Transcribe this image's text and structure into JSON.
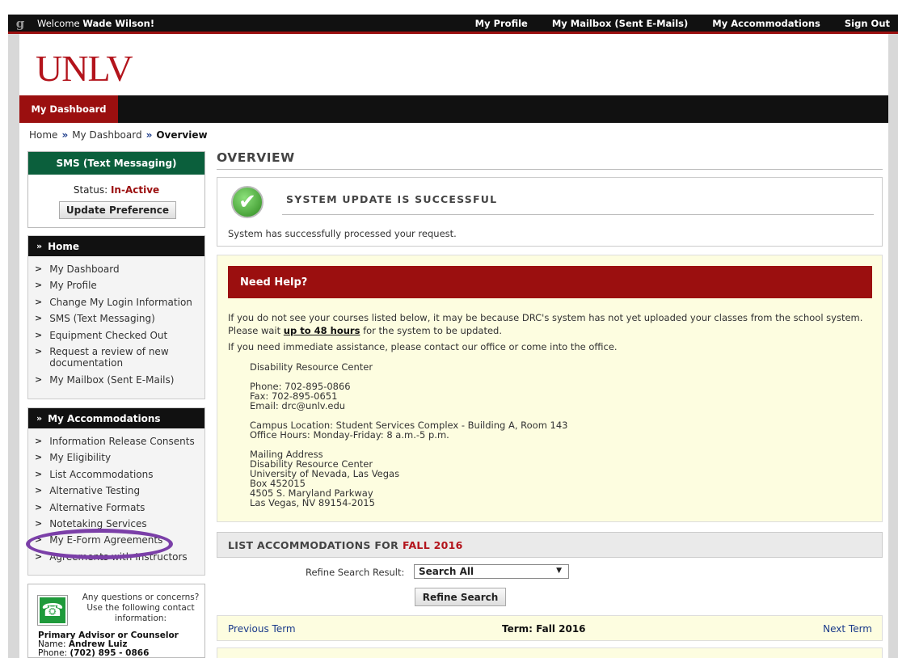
{
  "topbar": {
    "welcome_prefix": "Welcome",
    "user_name": "Wade Wilson!",
    "links": [
      "My Profile",
      "My Mailbox (Sent E-Mails)",
      "My Accommodations",
      "Sign Out"
    ]
  },
  "brand": {
    "name": "UNLV"
  },
  "nav": {
    "active_tab": "My Dashboard"
  },
  "breadcrumb": {
    "home": "Home",
    "dashboard": "My Dashboard",
    "current": "Overview",
    "sep": "»"
  },
  "sms": {
    "title": "SMS (Text Messaging)",
    "status_label": "Status:",
    "status_value": "In-Active",
    "button": "Update Preference"
  },
  "home_section": {
    "title": "Home",
    "items": [
      "My Dashboard",
      "My Profile",
      "Change My Login Information",
      "SMS (Text Messaging)",
      "Equipment Checked Out",
      "Request a review of new documentation",
      "My Mailbox (Sent E-Mails)"
    ]
  },
  "accommodations_section": {
    "title": "My Accommodations",
    "items": [
      "Information Release Consents",
      "My Eligibility",
      "List Accommodations",
      "Alternative Testing",
      "Alternative Formats",
      "Notetaking Services",
      "My E-Form Agreements",
      "Agreements with Instructors"
    ]
  },
  "contact": {
    "message": "Any questions or concerns? Use the following contact information:",
    "role": "Primary Advisor or Counselor",
    "name_label": "Name:",
    "name": "Andrew Luiz",
    "phone_label": "Phone:",
    "phone": "(702) 895 - 0866"
  },
  "main": {
    "title": "OVERVIEW",
    "success": {
      "title": "SYSTEM UPDATE IS SUCCESSFUL",
      "message": "System has successfully processed your request."
    },
    "help": {
      "title": "Need Help?",
      "p1_before": "If you do not see your courses listed below, it may be because DRC's system has not yet uploaded your classes from the school system. Please wait ",
      "p1_emph": "up to 48 hours",
      "p1_after": " for the system to be updated.",
      "p2": "If you need immediate assistance, please contact our office or come into the office.",
      "address": "Disability Resource Center\n\nPhone: 702-895-0866\nFax: 702-895-0651\nEmail: drc@unlv.edu\n\nCampus Location: Student Services Complex - Building A, Room 143\nOffice Hours: Monday-Friday: 8 a.m.-5 p.m.\n\nMailing Address\nDisability Resource Center\nUniversity of Nevada, Las Vegas\nBox 452015\n4505 S. Maryland Parkway\nLas Vegas, NV 89154-2015"
    },
    "list": {
      "title_prefix": "LIST ACCOMMODATIONS FOR",
      "term": "FALL 2016",
      "refine_label": "Refine Search Result:",
      "refine_value": "Search All",
      "refine_button": "Refine Search",
      "prev_term": "Previous Term",
      "current_term": "Term: Fall 2016",
      "next_term": "Next Term"
    }
  },
  "colors": {
    "brand_red": "#b3141c",
    "header_red": "#9b0f0f",
    "sms_green": "#0b5f3c",
    "highlight_oval": "#7b3fa8"
  }
}
